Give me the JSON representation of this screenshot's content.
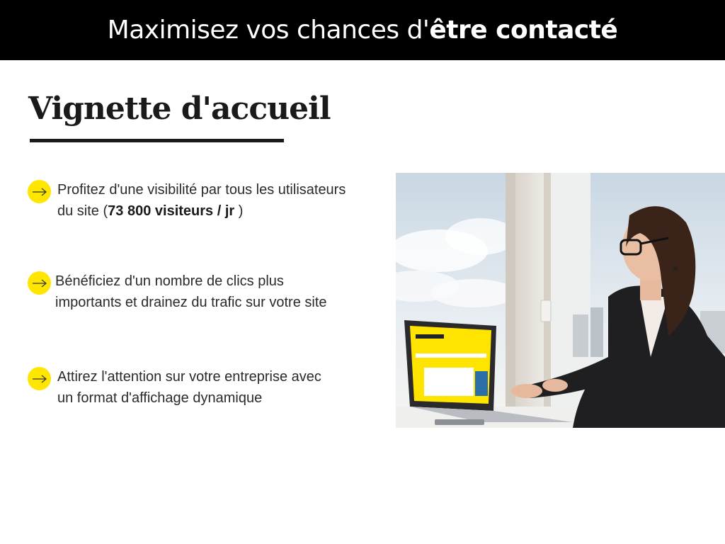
{
  "banner": {
    "title_light": "Maximisez vos chances d'",
    "title_bold": "être contacté"
  },
  "section": {
    "heading": "Vignette d'accueil"
  },
  "bullets": [
    {
      "icon": "arrow-right-icon",
      "line1": "Profitez d'une visibilité par tous les utilisateurs",
      "line2_prefix": "du site (",
      "line2_bold": "73 800 visiteurs / jr",
      "line2_suffix": " )"
    },
    {
      "icon": "arrow-right-icon",
      "line1": "Bénéficiez d'un nombre de clics plus",
      "line2": "importants et drainez du trafic sur votre site"
    },
    {
      "icon": "arrow-right-icon",
      "line1": "Attirez l'attention sur votre entreprise avec",
      "line2": "un format d'affichage dynamique"
    }
  ],
  "colors": {
    "banner_bg": "#000000",
    "accent_yellow": "#ffe600",
    "text_dark": "#1a1a1a"
  }
}
